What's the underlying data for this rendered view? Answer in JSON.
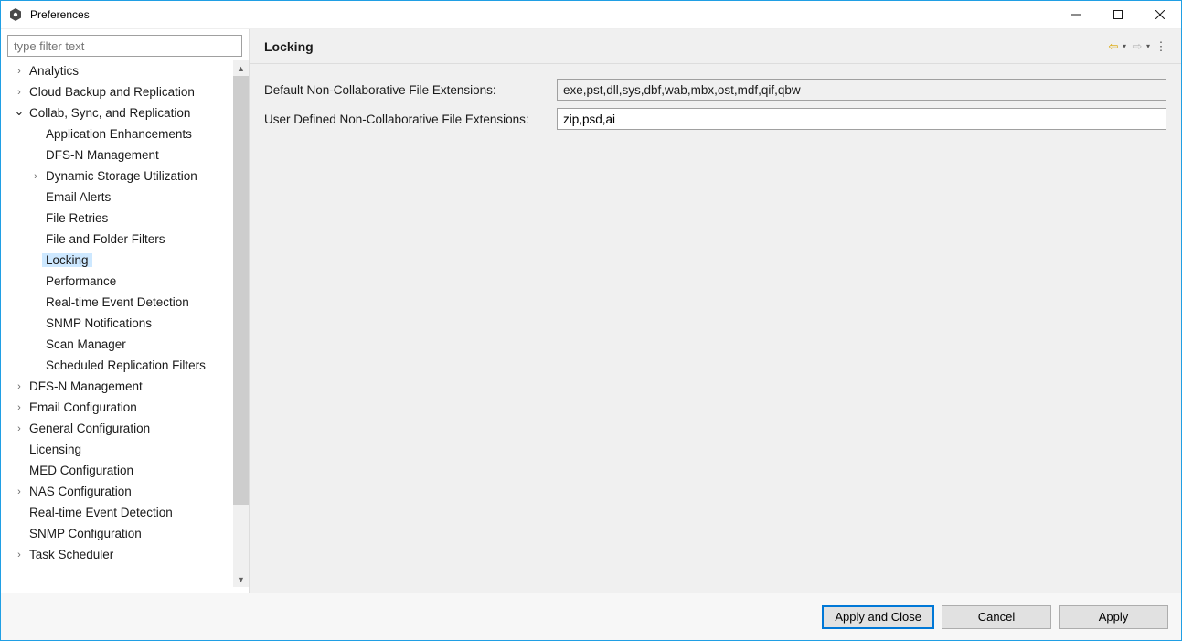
{
  "window": {
    "title": "Preferences"
  },
  "filter": {
    "placeholder": "type filter text"
  },
  "tree": [
    {
      "label": "Analytics",
      "depth": 1,
      "expandable": true,
      "expanded": false
    },
    {
      "label": "Cloud Backup and Replication",
      "depth": 1,
      "expandable": true,
      "expanded": false
    },
    {
      "label": "Collab, Sync, and Replication",
      "depth": 1,
      "expandable": true,
      "expanded": true
    },
    {
      "label": "Application Enhancements",
      "depth": 2,
      "expandable": false
    },
    {
      "label": "DFS-N Management",
      "depth": 2,
      "expandable": false
    },
    {
      "label": "Dynamic Storage Utilization",
      "depth": 2,
      "expandable": true,
      "expanded": false
    },
    {
      "label": "Email Alerts",
      "depth": 2,
      "expandable": false
    },
    {
      "label": "File Retries",
      "depth": 2,
      "expandable": false
    },
    {
      "label": "File and Folder Filters",
      "depth": 2,
      "expandable": false
    },
    {
      "label": "Locking",
      "depth": 2,
      "expandable": false,
      "selected": true
    },
    {
      "label": "Performance",
      "depth": 2,
      "expandable": false
    },
    {
      "label": "Real-time Event Detection",
      "depth": 2,
      "expandable": false
    },
    {
      "label": "SNMP Notifications",
      "depth": 2,
      "expandable": false
    },
    {
      "label": "Scan Manager",
      "depth": 2,
      "expandable": false
    },
    {
      "label": "Scheduled Replication Filters",
      "depth": 2,
      "expandable": false
    },
    {
      "label": "DFS-N Management",
      "depth": 1,
      "expandable": true,
      "expanded": false
    },
    {
      "label": "Email Configuration",
      "depth": 1,
      "expandable": true,
      "expanded": false
    },
    {
      "label": "General Configuration",
      "depth": 1,
      "expandable": true,
      "expanded": false
    },
    {
      "label": "Licensing",
      "depth": 1,
      "expandable": false
    },
    {
      "label": "MED Configuration",
      "depth": 1,
      "expandable": false
    },
    {
      "label": "NAS Configuration",
      "depth": 1,
      "expandable": true,
      "expanded": false
    },
    {
      "label": "Real-time Event Detection",
      "depth": 1,
      "expandable": false
    },
    {
      "label": "SNMP Configuration",
      "depth": 1,
      "expandable": false
    },
    {
      "label": "Task Scheduler",
      "depth": 1,
      "expandable": true,
      "expanded": false
    }
  ],
  "page": {
    "title": "Locking",
    "default_label": "Default Non-Collaborative File Extensions:",
    "default_value": "exe,pst,dll,sys,dbf,wab,mbx,ost,mdf,qif,qbw",
    "user_label": "User Defined Non-Collaborative File Extensions:",
    "user_value": "zip,psd,ai"
  },
  "buttons": {
    "apply_close": "Apply and Close",
    "cancel": "Cancel",
    "apply": "Apply"
  }
}
